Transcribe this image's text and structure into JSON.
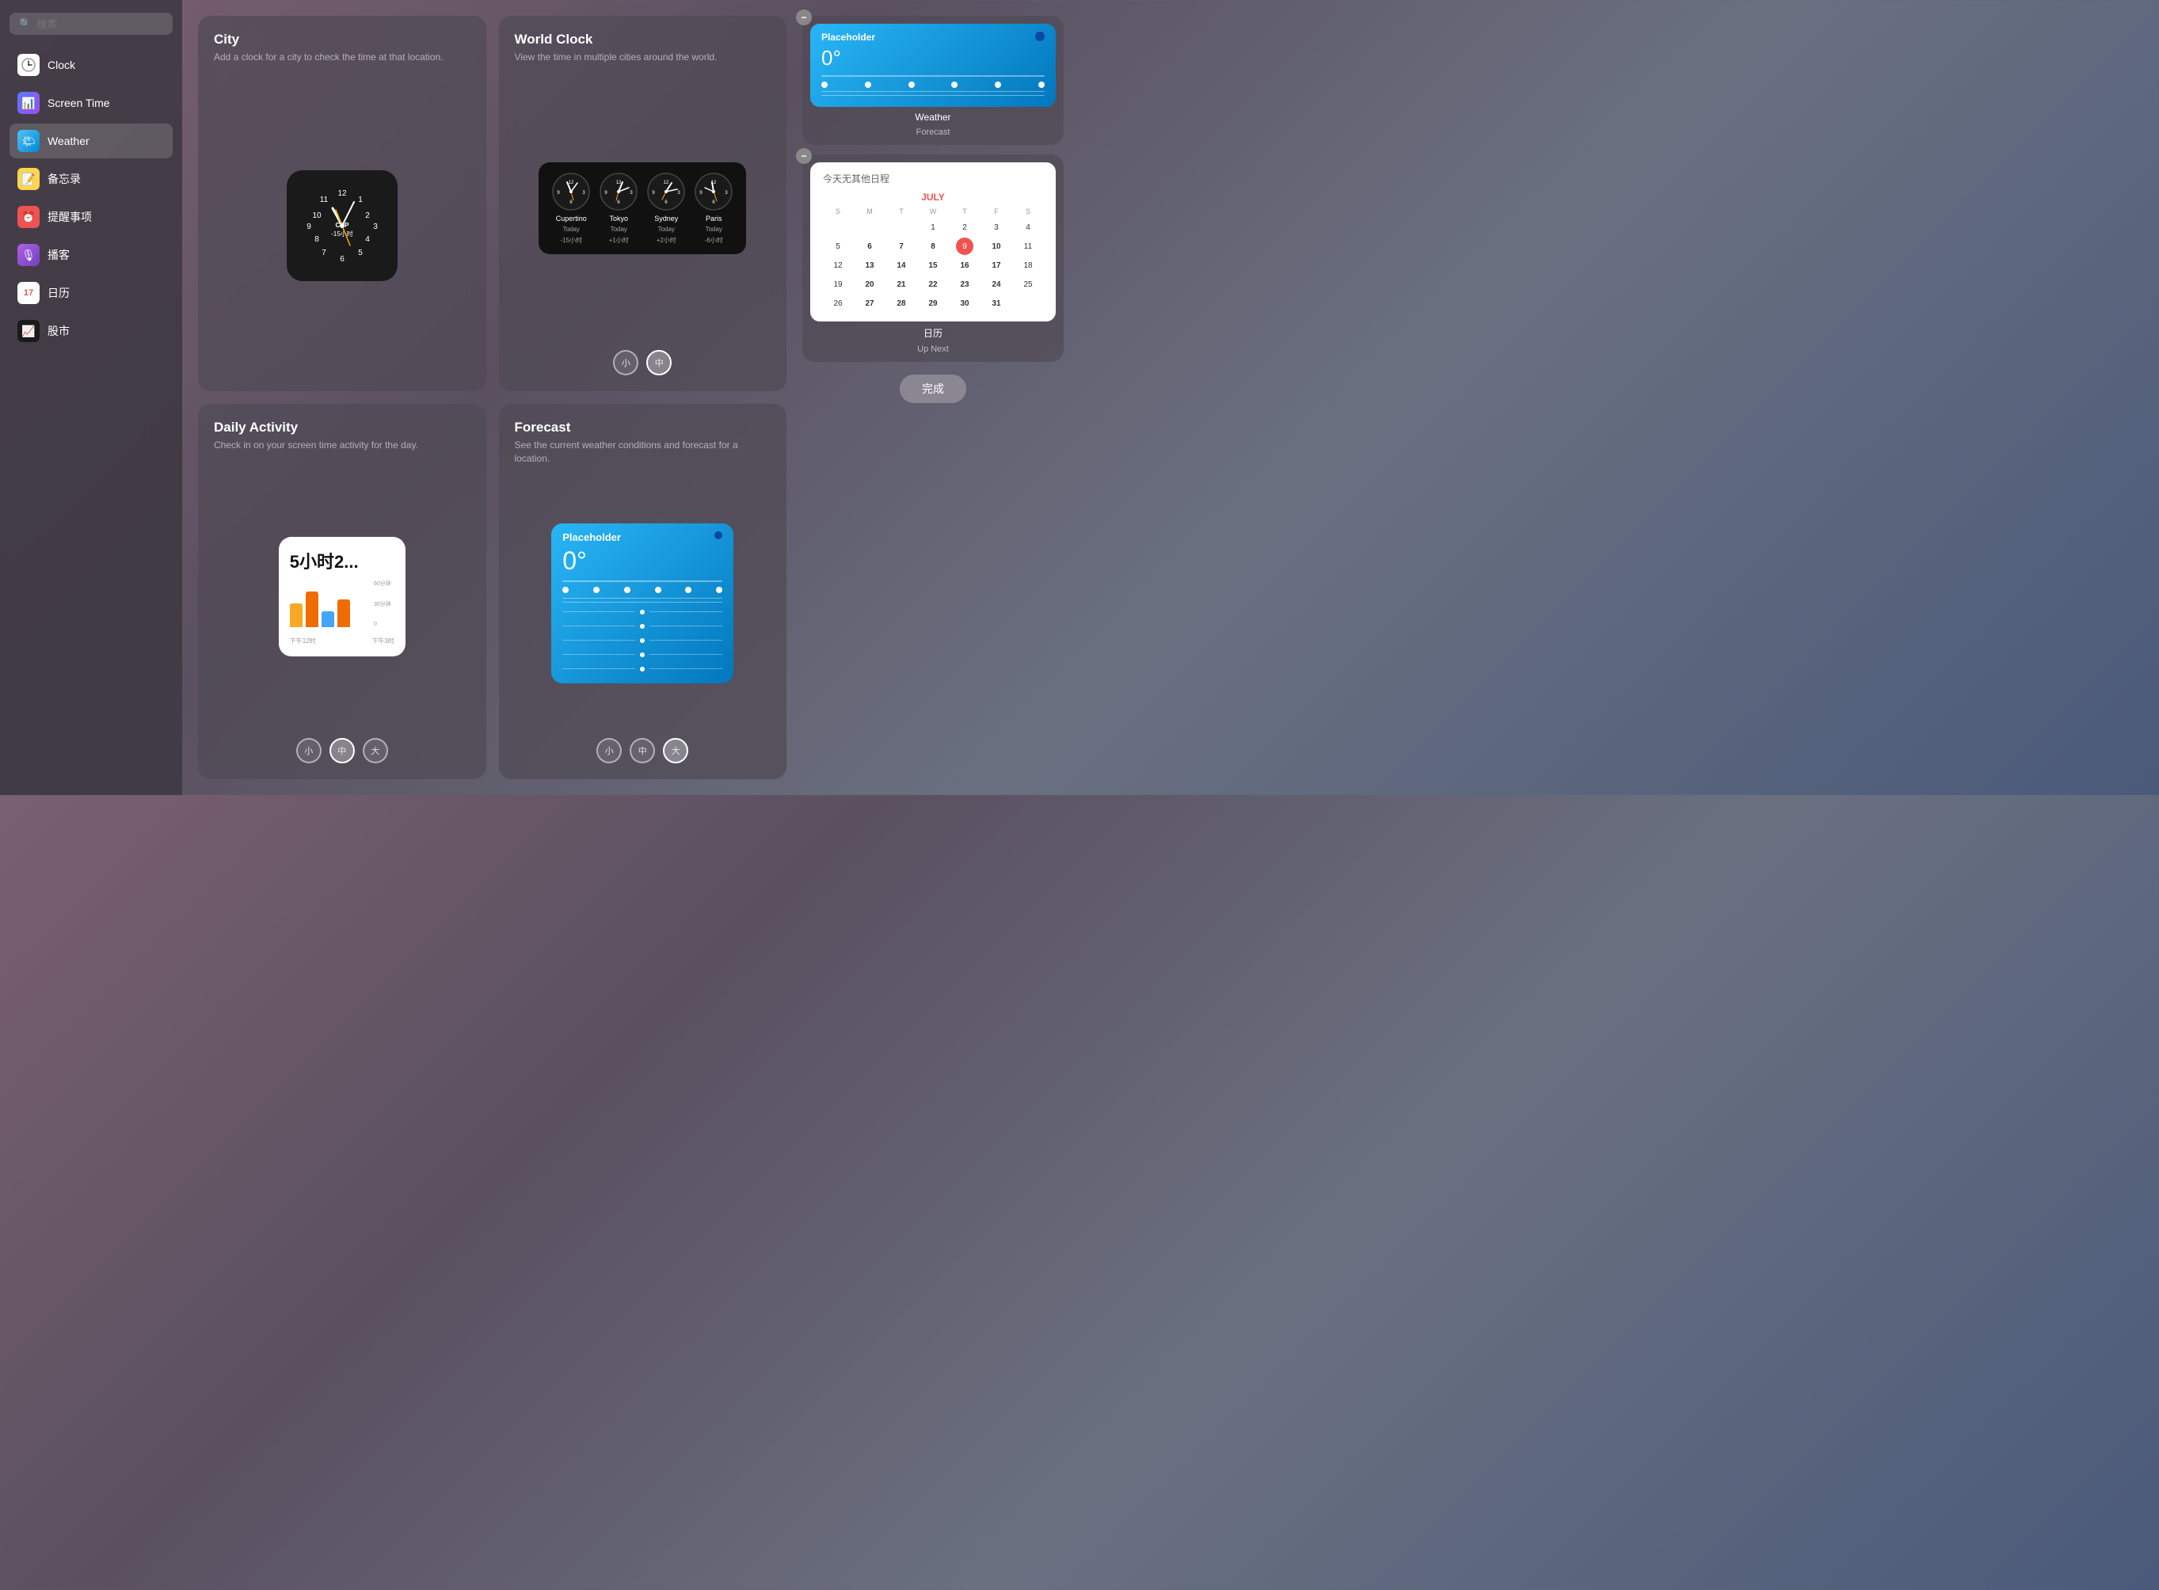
{
  "sidebar": {
    "search_placeholder": "搜索",
    "items": [
      {
        "id": "clock",
        "label": "Clock",
        "icon": "clock"
      },
      {
        "id": "screentime",
        "label": "Screen Time",
        "icon": "screentime"
      },
      {
        "id": "weather",
        "label": "Weather",
        "icon": "weather"
      },
      {
        "id": "notes",
        "label": "备忘录",
        "icon": "notes"
      },
      {
        "id": "reminders",
        "label": "提醒事项",
        "icon": "reminders"
      },
      {
        "id": "podcasts",
        "label": "播客",
        "icon": "podcasts"
      },
      {
        "id": "calendar",
        "label": "日历",
        "icon": "calendar"
      },
      {
        "id": "stocks",
        "label": "股市",
        "icon": "stocks"
      }
    ]
  },
  "panels": {
    "city": {
      "title": "City",
      "desc": "Add a clock for a city to check the time at that location."
    },
    "world_clock": {
      "title": "World Clock",
      "desc": "View the time in multiple cities around the world.",
      "cities": [
        {
          "name": "Cupertino",
          "sub": "Today\n-15小时"
        },
        {
          "name": "Tokyo",
          "sub": "Today\n+1小时"
        },
        {
          "name": "Sydney",
          "sub": "Today\n+2小时"
        },
        {
          "name": "Paris",
          "sub": "Today\n-6小时"
        }
      ],
      "sizes": [
        "小",
        "中"
      ]
    },
    "daily_activity": {
      "title": "Daily Activity",
      "desc": "Check in on your screen time activity for the day.",
      "time_display": "5小时2...",
      "sizes": [
        "小",
        "中",
        "大"
      ]
    },
    "forecast": {
      "title": "Forecast",
      "desc": "See the current weather conditions and forecast for a location.",
      "sizes": [
        "小",
        "中",
        "大"
      ]
    }
  },
  "right_panel": {
    "weather_widget": {
      "name": "Weather",
      "sub": "Forecast",
      "placeholder": "Placeholder",
      "temp": "0°",
      "dot_color": "#0d47a1"
    },
    "calendar_widget": {
      "name": "日历",
      "sub": "Up Next",
      "no_events": "今天无其他日程",
      "month": "JULY",
      "day_headers": [
        "S",
        "M",
        "T",
        "W",
        "T",
        "F",
        "S"
      ],
      "weeks": [
        [
          "",
          "",
          "",
          "1",
          "2",
          "3",
          "4"
        ],
        [
          "5",
          "6",
          "7",
          "8",
          "9",
          "10",
          "11"
        ],
        [
          "12",
          "13",
          "14",
          "15",
          "16",
          "17",
          "18"
        ],
        [
          "19",
          "20",
          "21",
          "22",
          "23",
          "24",
          "25"
        ],
        [
          "26",
          "27",
          "28",
          "29",
          "30",
          "31",
          ""
        ]
      ],
      "today": "9"
    },
    "done_button": "完成"
  },
  "weather_forecast_placeholder": "Placeholder",
  "weather_forecast_temp": "0°"
}
